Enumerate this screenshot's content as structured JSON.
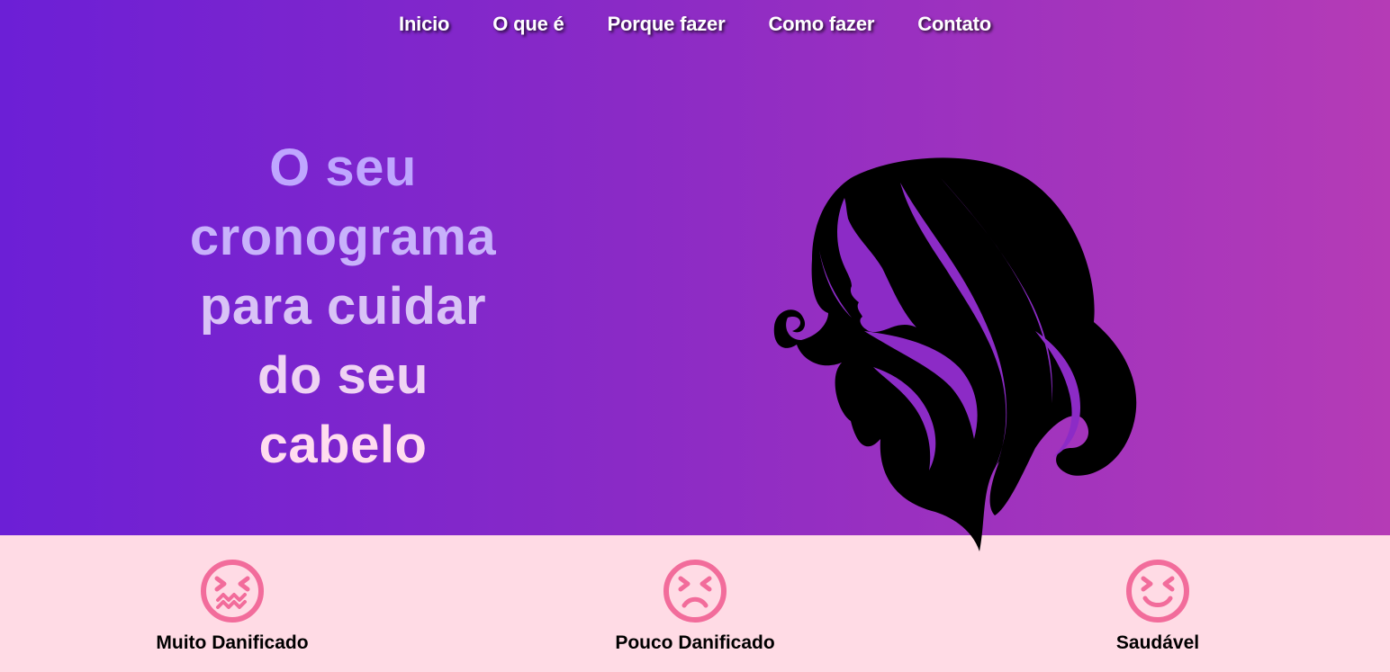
{
  "nav": {
    "items": [
      {
        "label": "Inicio"
      },
      {
        "label": "O que é"
      },
      {
        "label": "Porque fazer"
      },
      {
        "label": "Como fazer"
      },
      {
        "label": "Contato"
      }
    ]
  },
  "hero": {
    "headline_lines": [
      "O seu",
      "cronograma",
      "para cuidar",
      "do seu",
      "cabelo"
    ]
  },
  "statuses": [
    {
      "label": "Muito Danificado",
      "icon": "tired-face-icon"
    },
    {
      "label": "Pouco Danificado",
      "icon": "frowning-squint-face-icon"
    },
    {
      "label": "Saudável",
      "icon": "squinting-smile-face-icon"
    }
  ],
  "colors": {
    "gradient_start": "#6c1fd6",
    "gradient_end": "#b53bb6",
    "bottom_bg": "#ffdbe5",
    "icon_pink": "#f26c9b",
    "headline_top": "#b9a0ff",
    "headline_bottom": "#ffd9ef"
  }
}
